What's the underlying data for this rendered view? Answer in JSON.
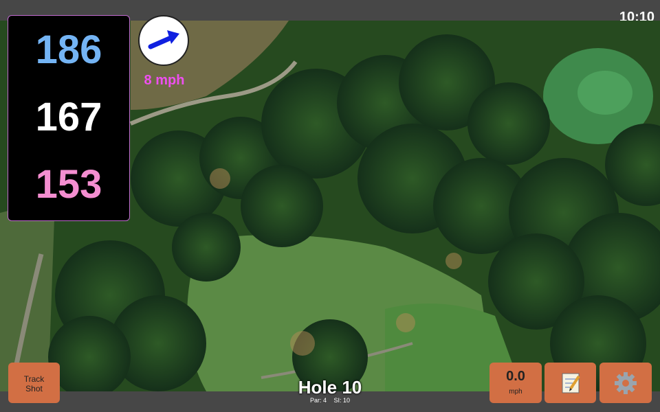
{
  "status": {
    "clock": "10:10"
  },
  "distances": {
    "back": "186",
    "middle": "167",
    "front": "153"
  },
  "wind": {
    "speed_label": "8 mph",
    "icon": "wind-arrow-icon"
  },
  "hole": {
    "title": "Hole 10",
    "par_label": "Par: 4",
    "si_label": "SI: 10"
  },
  "buttons": {
    "track_shot_line1": "Track",
    "track_shot_line2": "Shot",
    "speed_value": "0.0",
    "speed_unit": "mph",
    "notes_icon": "notepad-icon",
    "settings_icon": "gear-icon"
  },
  "colors": {
    "back_distance": "#74b4f4",
    "middle_distance": "#ffffff",
    "front_distance": "#f48ed0",
    "wind_text": "#ee4ff0",
    "button_bg": "#d26f44",
    "panel_border": "#c06ad0"
  }
}
